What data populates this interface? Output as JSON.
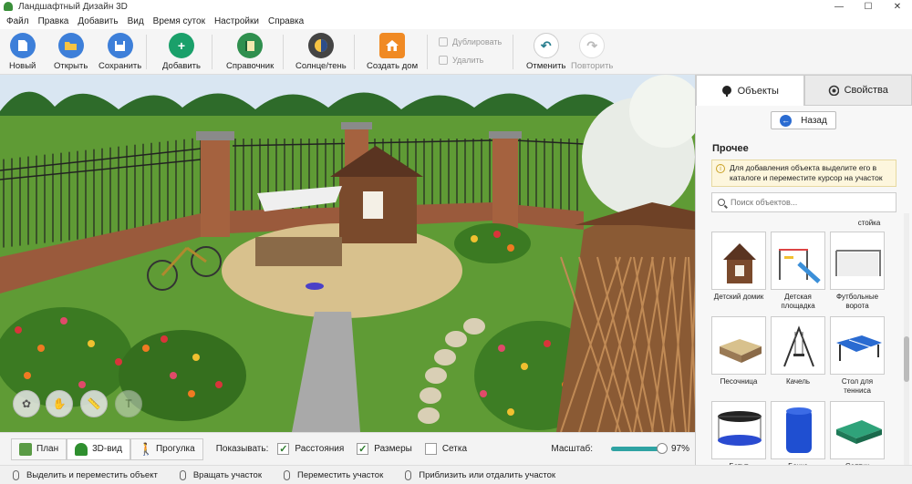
{
  "window": {
    "title": "Ландшафтный Дизайн 3D",
    "minimize": "—",
    "maximize": "☐",
    "close": "✕"
  },
  "menu": [
    "Файл",
    "Правка",
    "Добавить",
    "Вид",
    "Время суток",
    "Настройки",
    "Справка"
  ],
  "toolbar": {
    "new": "Новый",
    "open": "Открыть",
    "save": "Сохранить",
    "add": "Добавить",
    "reference": "Справочник",
    "sun_shadow": "Солнце/тень",
    "create_house": "Создать дом",
    "duplicate": "Дублировать",
    "delete": "Удалить",
    "undo": "Отменить",
    "redo": "Повторить"
  },
  "views": {
    "plan": "План",
    "view3d": "3D-вид",
    "walk": "Прогулка"
  },
  "show": {
    "label": "Показывать:",
    "distances": {
      "label": "Расстояния",
      "checked": true
    },
    "sizes": {
      "label": "Размеры",
      "checked": true
    },
    "grid": {
      "label": "Сетка",
      "checked": false
    }
  },
  "zoom": {
    "label": "Масштаб:",
    "value_text": "97%",
    "value": 0.97
  },
  "status": [
    "Выделить и переместить объект",
    "Вращать участок",
    "Переместить участок",
    "Приблизить или отдалить участок"
  ],
  "panel": {
    "tabs": {
      "objects": "Объекты",
      "properties": "Свойства"
    },
    "back": "Назад",
    "section": "Прочее",
    "hint": "Для добавления объекта выделите его в каталоге и переместите курсор на участок",
    "search_placeholder": "Поиск объектов...",
    "prev_label": "стойка",
    "items": [
      {
        "label": "Детский домик",
        "icon": "playhouse-icon"
      },
      {
        "label": "Детская площадка",
        "icon": "playground-icon"
      },
      {
        "label": "Футбольные ворота",
        "icon": "soccer-goal-icon"
      },
      {
        "label": "Песочница",
        "icon": "sandbox-icon"
      },
      {
        "label": "Качель",
        "icon": "swing-icon"
      },
      {
        "label": "Стол для тенниса",
        "icon": "tennis-table-icon"
      },
      {
        "label": "Батут",
        "icon": "trampoline-icon"
      },
      {
        "label": "Бочка пластиковая",
        "icon": "barrel-icon"
      },
      {
        "label": "Септик",
        "icon": "septic-icon"
      }
    ]
  },
  "colors": {
    "accent_blue": "#2a6bd1",
    "add_green": "#1aa06a",
    "house_orange": "#f08a24",
    "zoom_teal": "#2fa3a3"
  }
}
